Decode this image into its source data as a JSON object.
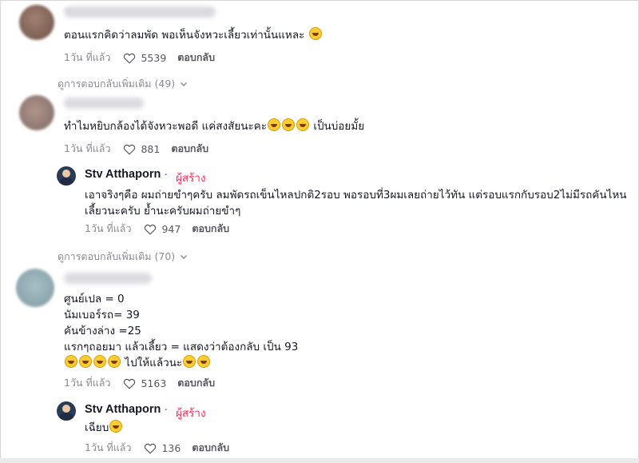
{
  "comments": [
    {
      "text": "ตอนแรกคิดว่าลมพัด พอเห็นจังหวะเลี้ยวเท่านั้นแหละ",
      "time": "1วัน ที่แล้ว",
      "likes": "5539",
      "reply_label": "ตอบกลับ"
    },
    {
      "text": "ทำไมหยิบกล้องได้จังหวะพอดี แค่สงสัยนะคะ",
      "text_suffix": "เป็นบ่อยมั้ย",
      "time": "1วัน ที่แล้ว",
      "likes": "881",
      "reply_label": "ตอบกลับ"
    },
    {
      "lines": [
        "ศูนย์เปล = 0",
        "นัมเบอร์รถ= 39",
        "คันข้างล่าง =25",
        "แรกๆถอยมา แล้วเลี้ยว = แสดงว่าต้องกลับ เป็น 93"
      ],
      "emoji_line_text": "ไปให้แล้วนะ",
      "time": "1วัน ที่แล้ว",
      "likes": "5163",
      "reply_label": "ตอบกลับ"
    }
  ],
  "more_replies": [
    {
      "label": "ดูการตอบกลับเพิ่มเติม (49)"
    },
    {
      "label": "ดูการตอบกลับเพิ่มเติม (70)"
    }
  ],
  "creator_replies": [
    {
      "name": "Stv Atthaporn",
      "dot": "·",
      "tag": "ผู้สร้าง",
      "lines": [
        "เอาจริงๆคือ ผมถ่ายขำๆครับ ลมพัดรถเข็นไหลปกติ2รอบ พอรอบที่3ผมเลยถ่ายไว้ทัน แต่รอบแรกกับรอบ2ไม่มีรถคันไหน",
        "เลี้ยวนะครับ ย้ำนะครับผมถ่ายขำๆ"
      ],
      "time": "1วัน ที่แล้ว",
      "likes": "947",
      "reply_label": "ตอบกลับ"
    },
    {
      "name": "Stv Atthaporn",
      "dot": "·",
      "tag": "ผู้สร้าง",
      "text": "เฉียบ",
      "time": "1วัน ที่แล้ว",
      "likes": "136",
      "reply_label": "ตอบกลับ"
    }
  ],
  "colors": {
    "creator_tag": "#fe2c55",
    "meta": "#8a8b91",
    "text": "#161823"
  },
  "icons": {
    "like": "heart-outline-icon",
    "expand": "chevron-down-icon",
    "emoji": "grinning-face-emoji"
  }
}
